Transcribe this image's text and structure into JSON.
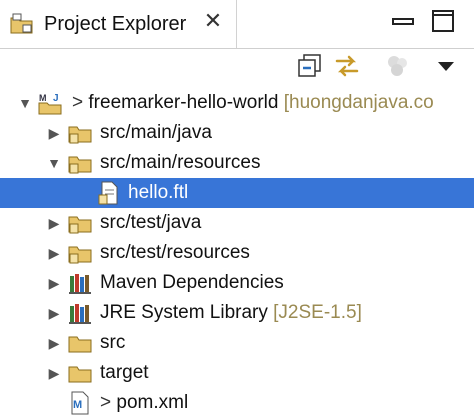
{
  "view": {
    "title": "Project Explorer",
    "close_glyph": "✕",
    "icons": [
      "project-explorer-icon",
      "close-icon",
      "minimize-icon",
      "maximize-icon"
    ]
  },
  "toolbar": {
    "icons": [
      "collapse-all-icon",
      "link-with-editor-icon",
      "focus-active-task-icon",
      "view-menu-icon"
    ]
  },
  "tree": [
    {
      "id": "project",
      "prefix": ">",
      "label": "freemarker-hello-world",
      "decoration": "[huongdanjava.co",
      "icon": "maven-project-icon",
      "expanded": true
    },
    {
      "id": "src-main-java",
      "label": "src/main/java",
      "icon": "source-folder-icon",
      "expanded": false
    },
    {
      "id": "src-main-resources",
      "label": "src/main/resources",
      "icon": "source-folder-icon",
      "expanded": true
    },
    {
      "id": "hello-ftl",
      "label": "hello.ftl",
      "icon": "file-icon",
      "selected": true
    },
    {
      "id": "src-test-java",
      "label": "src/test/java",
      "icon": "source-folder-icon",
      "expanded": false
    },
    {
      "id": "src-test-resources",
      "label": "src/test/resources",
      "icon": "source-folder-icon",
      "expanded": false
    },
    {
      "id": "maven-deps",
      "label": "Maven Dependencies",
      "icon": "library-icon",
      "expanded": false
    },
    {
      "id": "jre-lib",
      "label": "JRE System Library",
      "decoration": "[J2SE-1.5]",
      "icon": "library-icon",
      "expanded": false
    },
    {
      "id": "src",
      "label": "src",
      "icon": "folder-icon",
      "expanded": false
    },
    {
      "id": "target",
      "label": "target",
      "icon": "folder-icon",
      "expanded": false
    },
    {
      "id": "pom",
      "prefix": ">",
      "label": "pom.xml",
      "icon": "maven-pom-icon"
    }
  ],
  "colors": {
    "selection": "#3875d7",
    "decoration": "#9a8a52"
  }
}
